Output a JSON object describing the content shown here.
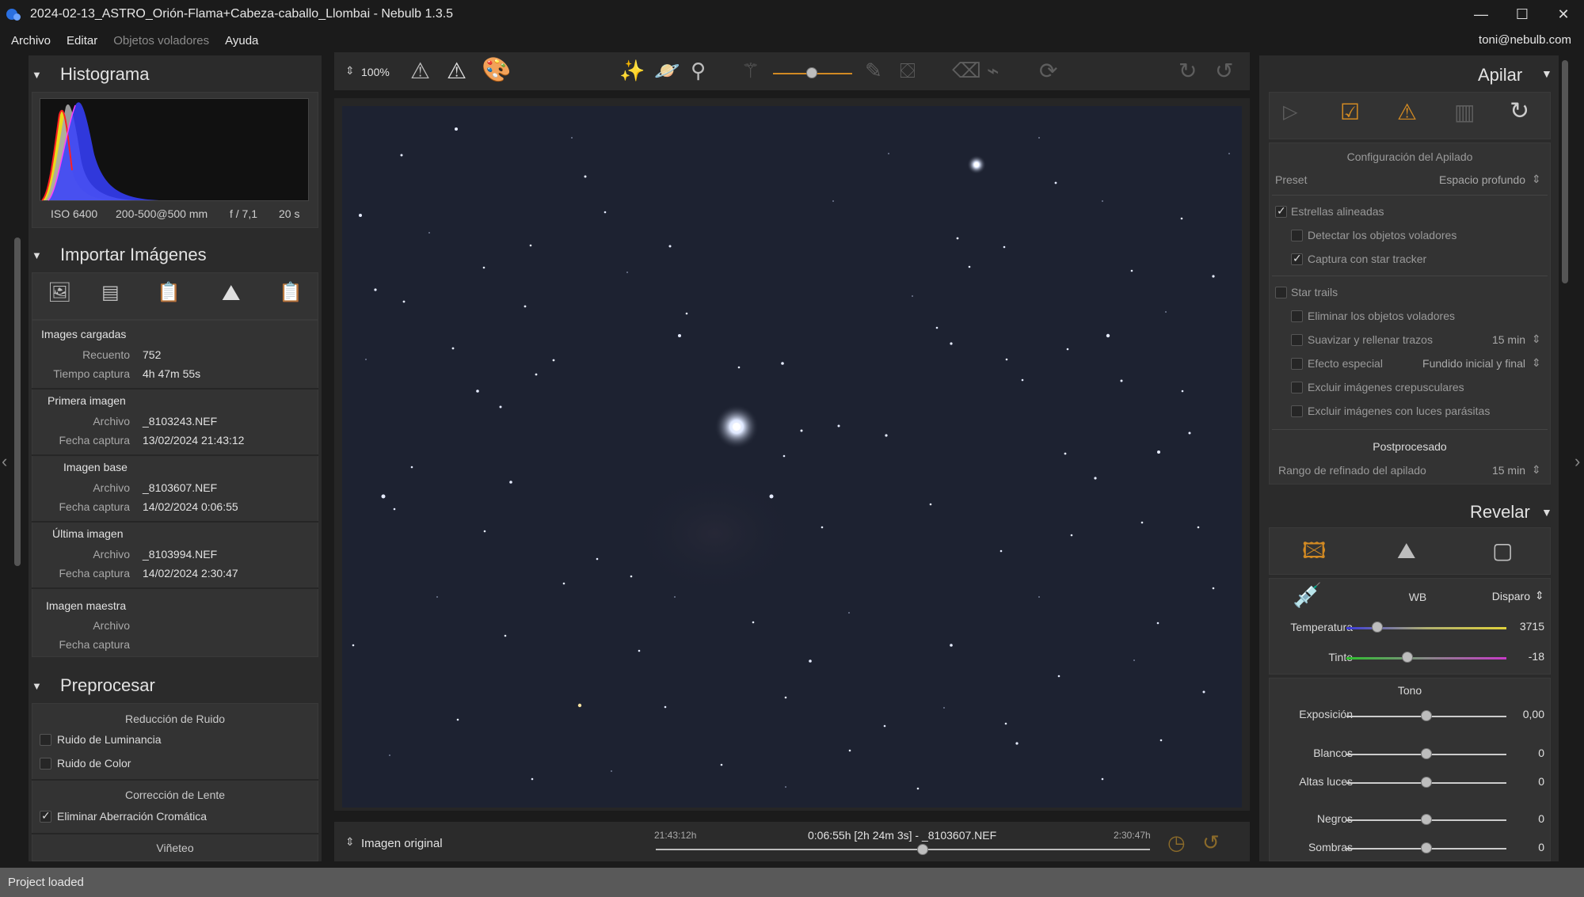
{
  "window": {
    "title": "2024-02-13_ASTRO_Orión-Flama+Cabeza-caballo_Llombai - Nebulb 1.3.5"
  },
  "menu": {
    "items": [
      "Archivo",
      "Editar",
      "Objetos voladores",
      "Ayuda"
    ],
    "user": "toni@nebulb.com"
  },
  "left": {
    "histogram": {
      "title": "Histograma",
      "iso": "ISO 6400",
      "lens": "200-500@500 mm",
      "aperture": "f / 7,1",
      "shutter": "20 s"
    },
    "import": {
      "title": "Importar Imágenes",
      "loaded_title": "Images cargadas",
      "count_label": "Recuento",
      "count": "752",
      "time_label": "Tiempo captura",
      "time": "4h 47m 55s",
      "file_label": "Archivo",
      "date_label": "Fecha captura",
      "first_title": "Primera imagen",
      "first_file": "_8103243.NEF",
      "first_date": "13/02/2024 21:43:12",
      "base_title": "Imagen base",
      "base_file": "_8103607.NEF",
      "base_date": "14/02/2024 0:06:55",
      "last_title": "Última imagen",
      "last_file": "_8103994.NEF",
      "last_date": "14/02/2024 2:30:47",
      "master_title": "Imagen maestra"
    },
    "preprocess": {
      "title": "Preprocesar",
      "noise_title": "Reducción de Ruido",
      "luminance": "Ruido de Luminancia",
      "color": "Ruido de Color",
      "lens_title": "Corrección de Lente",
      "aberration": "Eliminar Aberración Cromática",
      "vignette": "Viñeteo"
    }
  },
  "toolbar": {
    "zoom": "100%"
  },
  "bottom": {
    "view": "Imagen original",
    "start": "21:43:12h",
    "current": "0:06:55h [2h 24m 3s] - _8103607.NEF",
    "end": "2:30:47h",
    "position": 0.54
  },
  "right": {
    "stack": {
      "title": "Apilar",
      "config_title": "Configuración del Apilado",
      "preset_label": "Preset",
      "preset": "Espacio profundo",
      "aligned": "Estrellas alineadas",
      "detect": "Detectar los objetos voladores",
      "tracker": "Captura con star tracker",
      "trails": "Star trails",
      "remove": "Eliminar los objetos voladores",
      "smooth": "Suavizar y rellenar trazos",
      "smooth_val": "15 min",
      "effect": "Efecto especial",
      "effect_val": "Fundido inicial y final",
      "twilight": "Excluir imágenes crepusculares",
      "parasitic": "Excluir imágenes con luces parásitas",
      "post_title": "Postprocesado",
      "refine": "Rango de refinado del apilado",
      "refine_val": "15 min"
    },
    "develop": {
      "title": "Revelar",
      "wb_label": "WB",
      "wb": "Disparo",
      "temp_label": "Temperatura",
      "temp": "3715",
      "tint_label": "Tinte",
      "tint": "-18",
      "tone_title": "Tono",
      "exposure_label": "Exposición",
      "exposure": "0,00",
      "whites_label": "Blancos",
      "whites": "0",
      "highlights_label": "Altas luces",
      "highlights": "0",
      "blacks_label": "Negros",
      "blacks": "0",
      "shadows_label": "Sombras",
      "shadows": "0"
    }
  },
  "status": {
    "text": "Project loaded"
  },
  "colors": {
    "accent": "#d28a23",
    "panel": "#2b2b2b",
    "sky": "#1d2231",
    "status": "#595959"
  }
}
